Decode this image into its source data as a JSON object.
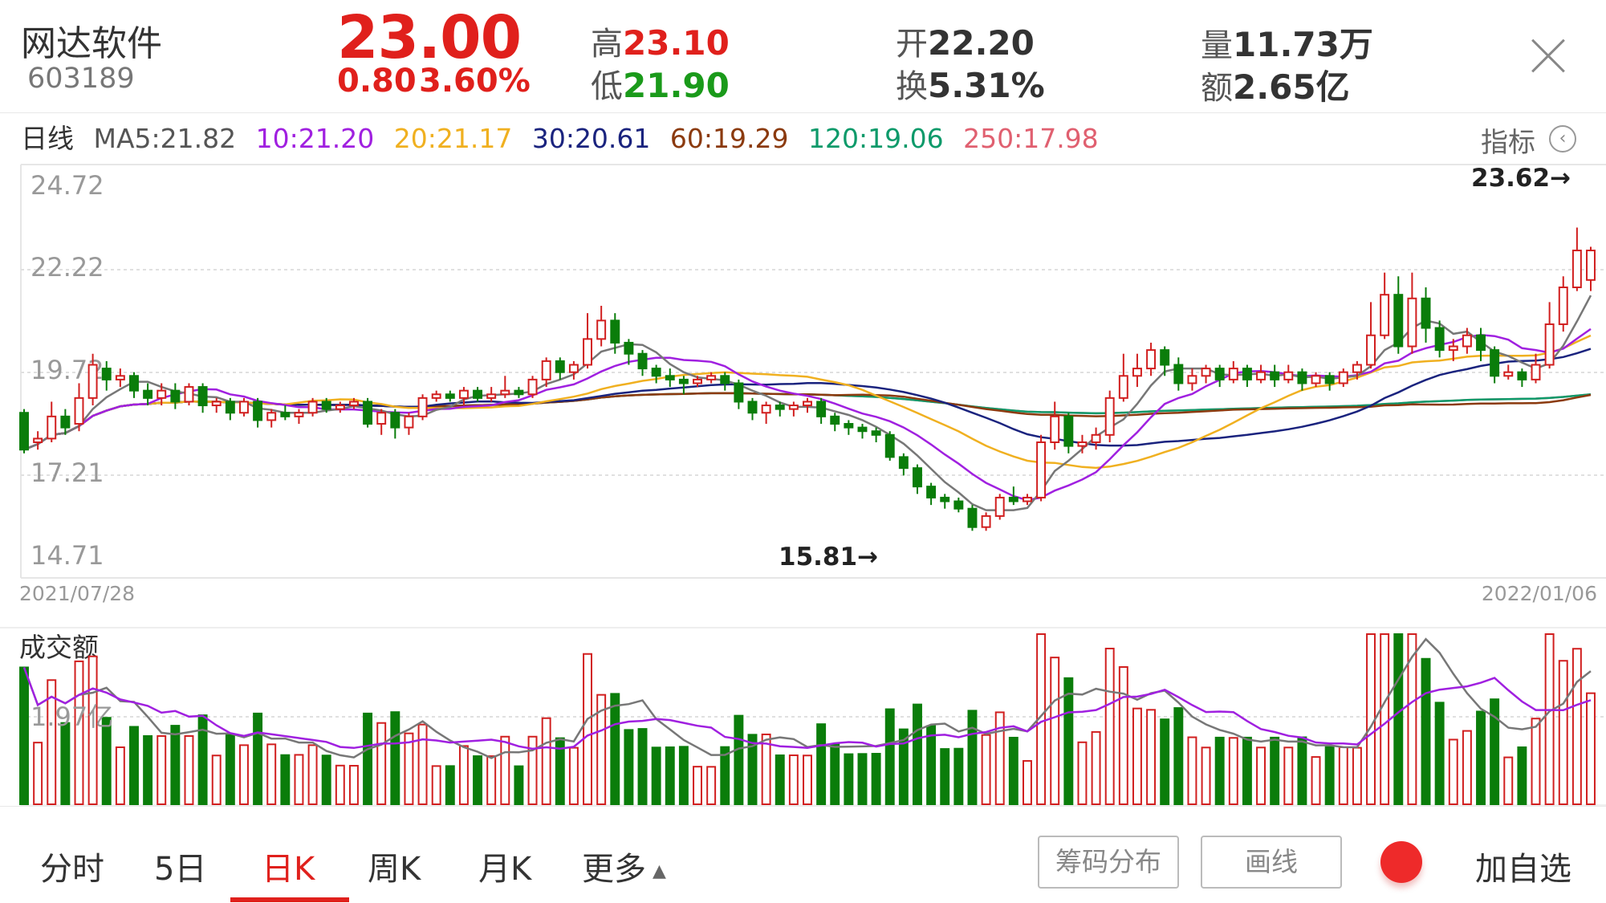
{
  "header": {
    "name": "网达软件",
    "code": "603189",
    "price": "23.00",
    "change": "0.80",
    "change_pct": "3.60%",
    "quotes": {
      "high_label": "高",
      "high": "23.10",
      "low_label": "低",
      "low": "21.90",
      "open_label": "开",
      "open": "22.20",
      "turnover_label": "换",
      "turnover": "5.31%",
      "volume_label": "量",
      "volume": "11.73万",
      "amount_label": "额",
      "amount": "2.65亿"
    },
    "close_icon": "close-icon"
  },
  "indicator_row": {
    "period": "日线",
    "ma5": "MA5:21.82",
    "ma10": "10:21.20",
    "ma20": "20:21.17",
    "ma30": "30:20.61",
    "ma60": "60:19.29",
    "ma120": "120:19.06",
    "ma250": "250:17.98",
    "indicator_label": "指标"
  },
  "colors": {
    "up": "#d11f1f",
    "down": "#0a7d0a",
    "price_up": "#e0201c",
    "price_down": "#1a9a1a",
    "ma5": "#777777",
    "ma10": "#a020e0",
    "ma20": "#f0b020",
    "ma30": "#1a237e",
    "ma60": "#8b3a0e",
    "ma120": "#0d9a6a",
    "ma250": "#e06070"
  },
  "chart_data": [
    {
      "type": "candlestick",
      "y_ticks": [
        "24.72",
        "22.22",
        "19.72",
        "17.21",
        "14.71"
      ],
      "ylim": [
        14.71,
        24.72
      ],
      "x_start_label": "2021/07/28",
      "x_end_label": "2022/01/06",
      "max_label": "23.62→",
      "min_label": "15.81→",
      "candles": [
        [
          18.6,
          17.6,
          18.7,
          17.5
        ],
        [
          17.8,
          17.9,
          18.1,
          17.6
        ],
        [
          17.9,
          18.5,
          18.9,
          17.8
        ],
        [
          18.5,
          18.2,
          18.7,
          18.0
        ],
        [
          18.3,
          19.0,
          19.4,
          18.1
        ],
        [
          19.0,
          19.9,
          20.2,
          18.8
        ],
        [
          19.8,
          19.5,
          20.0,
          19.2
        ],
        [
          19.5,
          19.6,
          19.8,
          19.3
        ],
        [
          19.6,
          19.2,
          19.7,
          19.0
        ],
        [
          19.2,
          19.0,
          19.4,
          18.8
        ],
        [
          19.0,
          19.2,
          19.4,
          18.8
        ],
        [
          19.2,
          18.9,
          19.4,
          18.7
        ],
        [
          18.9,
          19.3,
          19.4,
          18.8
        ],
        [
          19.3,
          18.8,
          19.4,
          18.6
        ],
        [
          18.8,
          18.9,
          19.0,
          18.6
        ],
        [
          18.9,
          18.6,
          19.0,
          18.4
        ],
        [
          18.6,
          18.9,
          19.0,
          18.5
        ],
        [
          18.9,
          18.4,
          19.0,
          18.2
        ],
        [
          18.4,
          18.6,
          18.7,
          18.2
        ],
        [
          18.6,
          18.5,
          18.8,
          18.4
        ],
        [
          18.5,
          18.6,
          18.7,
          18.3
        ],
        [
          18.6,
          18.9,
          19.0,
          18.5
        ],
        [
          18.9,
          18.7,
          19.0,
          18.6
        ],
        [
          18.7,
          18.8,
          18.9,
          18.6
        ],
        [
          18.8,
          18.9,
          19.0,
          18.7
        ],
        [
          18.9,
          18.3,
          19.0,
          18.2
        ],
        [
          18.3,
          18.6,
          18.7,
          18.0
        ],
        [
          18.6,
          18.2,
          18.7,
          17.9
        ],
        [
          18.2,
          18.5,
          18.6,
          18.0
        ],
        [
          18.5,
          19.0,
          19.1,
          18.4
        ],
        [
          19.0,
          19.1,
          19.2,
          18.9
        ],
        [
          19.1,
          19.0,
          19.2,
          18.9
        ],
        [
          19.0,
          19.2,
          19.3,
          18.8
        ],
        [
          19.2,
          19.0,
          19.3,
          18.9
        ],
        [
          19.0,
          19.1,
          19.3,
          18.9
        ],
        [
          19.1,
          19.2,
          19.6,
          19.0
        ],
        [
          19.2,
          19.1,
          19.3,
          19.0
        ],
        [
          19.1,
          19.5,
          19.6,
          19.0
        ],
        [
          19.5,
          20.0,
          20.1,
          19.3
        ],
        [
          20.0,
          19.7,
          20.1,
          19.5
        ],
        [
          19.7,
          19.9,
          20.0,
          19.5
        ],
        [
          19.9,
          20.6,
          21.3,
          19.8
        ],
        [
          20.6,
          21.1,
          21.5,
          20.4
        ],
        [
          21.1,
          20.5,
          21.3,
          20.2
        ],
        [
          20.5,
          20.2,
          20.6,
          19.9
        ],
        [
          20.2,
          19.8,
          20.3,
          19.6
        ],
        [
          19.8,
          19.6,
          19.9,
          19.4
        ],
        [
          19.6,
          19.5,
          19.8,
          19.3
        ],
        [
          19.5,
          19.4,
          19.6,
          19.1
        ],
        [
          19.4,
          19.5,
          19.6,
          19.3
        ],
        [
          19.5,
          19.6,
          19.7,
          19.4
        ],
        [
          19.6,
          19.4,
          19.7,
          19.2
        ],
        [
          19.4,
          18.9,
          19.5,
          18.7
        ],
        [
          18.9,
          18.6,
          19.0,
          18.4
        ],
        [
          18.6,
          18.8,
          18.9,
          18.3
        ],
        [
          18.8,
          18.7,
          18.9,
          18.5
        ],
        [
          18.7,
          18.8,
          18.9,
          18.5
        ],
        [
          18.8,
          18.9,
          19.0,
          18.6
        ],
        [
          18.9,
          18.5,
          19.0,
          18.3
        ],
        [
          18.5,
          18.3,
          18.6,
          18.1
        ],
        [
          18.3,
          18.2,
          18.4,
          18.0
        ],
        [
          18.2,
          18.1,
          18.3,
          17.9
        ],
        [
          18.1,
          18.0,
          18.2,
          17.8
        ],
        [
          18.0,
          17.4,
          18.1,
          17.3
        ],
        [
          17.4,
          17.1,
          17.5,
          16.9
        ],
        [
          17.1,
          16.6,
          17.2,
          16.4
        ],
        [
          16.6,
          16.3,
          16.7,
          16.1
        ],
        [
          16.3,
          16.2,
          16.4,
          16.0
        ],
        [
          16.2,
          16.0,
          16.3,
          15.9
        ],
        [
          16.0,
          15.5,
          16.1,
          15.4
        ],
        [
          15.5,
          15.8,
          15.9,
          15.4
        ],
        [
          15.8,
          16.3,
          16.4,
          15.7
        ],
        [
          16.3,
          16.2,
          16.6,
          16.1
        ],
        [
          16.2,
          16.3,
          16.4,
          16.1
        ],
        [
          16.3,
          17.8,
          18.0,
          16.2
        ],
        [
          17.8,
          18.5,
          18.9,
          17.6
        ],
        [
          18.5,
          17.7,
          18.6,
          17.5
        ],
        [
          17.7,
          17.8,
          18.0,
          17.5
        ],
        [
          17.8,
          18.0,
          18.2,
          17.6
        ],
        [
          18.0,
          19.0,
          19.2,
          17.8
        ],
        [
          19.0,
          19.6,
          20.2,
          18.9
        ],
        [
          19.6,
          19.8,
          20.2,
          19.3
        ],
        [
          19.8,
          20.3,
          20.5,
          19.6
        ],
        [
          20.3,
          19.9,
          20.4,
          19.6
        ],
        [
          19.9,
          19.4,
          20.1,
          19.2
        ],
        [
          19.4,
          19.6,
          19.8,
          19.2
        ],
        [
          19.6,
          19.8,
          19.9,
          19.4
        ],
        [
          19.8,
          19.5,
          19.9,
          19.3
        ],
        [
          19.5,
          19.8,
          20.0,
          19.4
        ],
        [
          19.8,
          19.5,
          19.9,
          19.3
        ],
        [
          19.5,
          19.7,
          19.9,
          19.4
        ],
        [
          19.7,
          19.5,
          19.9,
          19.3
        ],
        [
          19.5,
          19.7,
          19.9,
          19.4
        ],
        [
          19.7,
          19.4,
          19.8,
          19.2
        ],
        [
          19.4,
          19.6,
          19.7,
          19.3
        ],
        [
          19.6,
          19.4,
          19.7,
          19.2
        ],
        [
          19.4,
          19.7,
          19.8,
          19.3
        ],
        [
          19.7,
          19.9,
          20.0,
          19.5
        ],
        [
          19.9,
          20.7,
          21.6,
          19.8
        ],
        [
          20.7,
          21.8,
          22.4,
          20.6
        ],
        [
          21.8,
          20.4,
          22.3,
          20.2
        ],
        [
          20.4,
          21.7,
          22.4,
          20.2
        ],
        [
          21.7,
          20.9,
          22.0,
          20.5
        ],
        [
          20.9,
          20.3,
          21.1,
          20.1
        ],
        [
          20.3,
          20.4,
          20.6,
          20.0
        ],
        [
          20.4,
          20.7,
          20.9,
          20.2
        ],
        [
          20.7,
          20.3,
          20.9,
          20.0
        ],
        [
          20.3,
          19.6,
          20.4,
          19.4
        ],
        [
          19.6,
          19.7,
          19.9,
          19.5
        ],
        [
          19.7,
          19.5,
          19.8,
          19.3
        ],
        [
          19.5,
          19.9,
          20.2,
          19.4
        ],
        [
          19.9,
          21.0,
          21.6,
          19.8
        ],
        [
          21.0,
          22.0,
          22.3,
          20.8
        ],
        [
          22.0,
          23.0,
          23.62,
          21.9
        ],
        [
          22.2,
          23.0,
          23.1,
          21.9
        ]
      ]
    },
    {
      "type": "bar",
      "title": "成交额",
      "y_tick": "1.97亿"
    }
  ],
  "tabs": [
    "分时",
    "5日",
    "日K",
    "周K",
    "月K",
    "更多"
  ],
  "active_tab": "日K",
  "buttons": {
    "chip_distribution": "筹码分布",
    "draw_line": "画线",
    "add_favorite": "加自选"
  }
}
